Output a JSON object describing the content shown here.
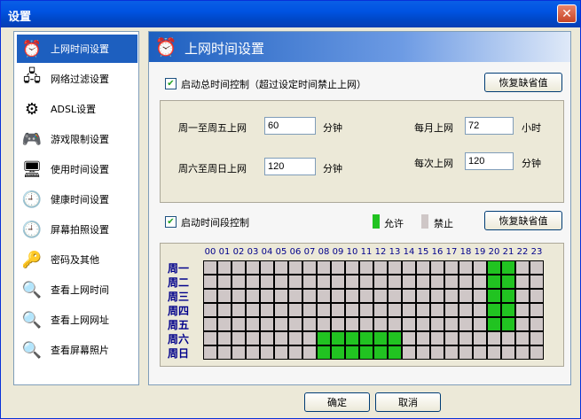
{
  "window": {
    "title": "设置"
  },
  "sidebar": {
    "items": [
      {
        "label": "上网时间设置",
        "icon": "alarm-clock-icon",
        "glyph": "⏰",
        "active": true
      },
      {
        "label": "网络过滤设置",
        "icon": "network-icon",
        "glyph": "🖧",
        "active": false
      },
      {
        "label": "ADSL设置",
        "icon": "gear-icon",
        "glyph": "⚙",
        "active": false
      },
      {
        "label": "游戏限制设置",
        "icon": "gamepad-icon",
        "glyph": "🎮",
        "active": false
      },
      {
        "label": "使用时间设置",
        "icon": "monitor-icon",
        "glyph": "🖥",
        "active": false
      },
      {
        "label": "健康时间设置",
        "icon": "clock-icon",
        "glyph": "🕘",
        "active": false
      },
      {
        "label": "屏幕拍照设置",
        "icon": "clock-icon",
        "glyph": "🕘",
        "active": false
      },
      {
        "label": "密码及其他",
        "icon": "key-icon",
        "glyph": "🔑",
        "active": false
      },
      {
        "label": "查看上网时间",
        "icon": "magnifier-icon",
        "glyph": "🔍",
        "active": false
      },
      {
        "label": "查看上网网址",
        "icon": "magnifier-icon",
        "glyph": "🔍",
        "active": false
      },
      {
        "label": "查看屏幕照片",
        "icon": "magnifier-icon",
        "glyph": "🔍",
        "active": false
      }
    ]
  },
  "main": {
    "header_title": "上网时间设置",
    "total_control": {
      "label": "启动总时间控制（超过设定时间禁止上网）",
      "checked": true,
      "restore_label": "恢复缺省值"
    },
    "limits": {
      "weekday_label": "周一至周五上网",
      "weekday_value": "60",
      "weekday_unit": "分钟",
      "weekend_label": "周六至周日上网",
      "weekend_value": "120",
      "weekend_unit": "分钟",
      "monthly_label": "每月上网",
      "monthly_value": "72",
      "monthly_unit": "小时",
      "session_label": "每次上网",
      "session_value": "120",
      "session_unit": "分钟"
    },
    "period_control": {
      "label": "启动时间段控制",
      "checked": true,
      "allow_label": "允许",
      "deny_label": "禁止",
      "restore_label": "恢复缺省值",
      "allow_color": "#21c321",
      "deny_color": "#cfc7c7"
    },
    "schedule": {
      "hours": [
        "00",
        "01",
        "02",
        "03",
        "04",
        "05",
        "06",
        "07",
        "08",
        "09",
        "10",
        "11",
        "12",
        "13",
        "14",
        "15",
        "16",
        "17",
        "18",
        "19",
        "20",
        "21",
        "22",
        "23"
      ],
      "days": [
        "周一",
        "周二",
        "周三",
        "周四",
        "周五",
        "周六",
        "周日"
      ],
      "allowed": [
        [
          20,
          21
        ],
        [
          20,
          21
        ],
        [
          20,
          21
        ],
        [
          20,
          21
        ],
        [
          20,
          21
        ],
        [
          8,
          9,
          10,
          11,
          12,
          13
        ],
        [
          8,
          9,
          10,
          11,
          12,
          13
        ]
      ]
    }
  },
  "footer": {
    "ok_label": "确定",
    "cancel_label": "取消"
  }
}
